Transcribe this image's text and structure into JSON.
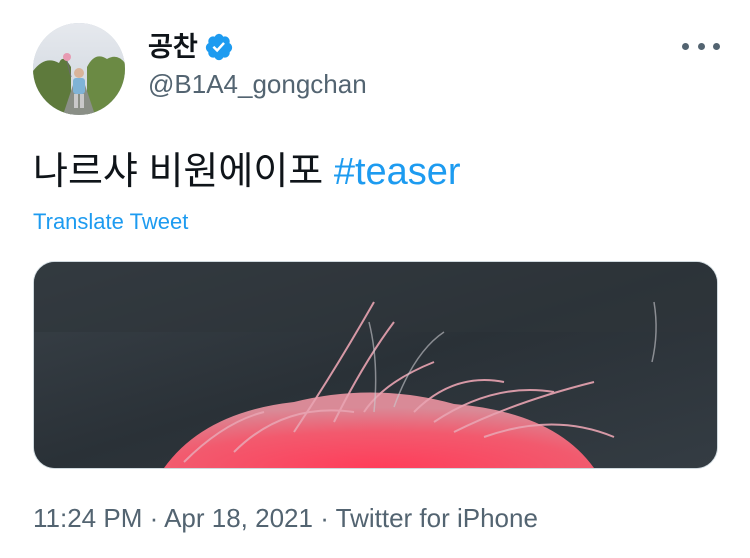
{
  "author": {
    "display_name": "공찬",
    "handle": "@B1A4_gongchan",
    "verified": true,
    "verified_icon": "verified-badge-icon",
    "avatar_icon": "avatar-photo"
  },
  "menu": {
    "more_icon": "more-options-icon"
  },
  "tweet": {
    "text": "나르샤 비원에이포",
    "hashtag": "#teaser",
    "translate_label": "Translate Tweet"
  },
  "media": {
    "description_icon": "teaser-photo-pink-hair"
  },
  "meta": {
    "time": "11:24 PM",
    "separator": "·",
    "date": "Apr 18, 2021",
    "source": "Twitter for iPhone"
  },
  "colors": {
    "link": "#1d9bf0",
    "text": "#0f1419",
    "secondary": "#536471",
    "border": "#cfd9de"
  }
}
